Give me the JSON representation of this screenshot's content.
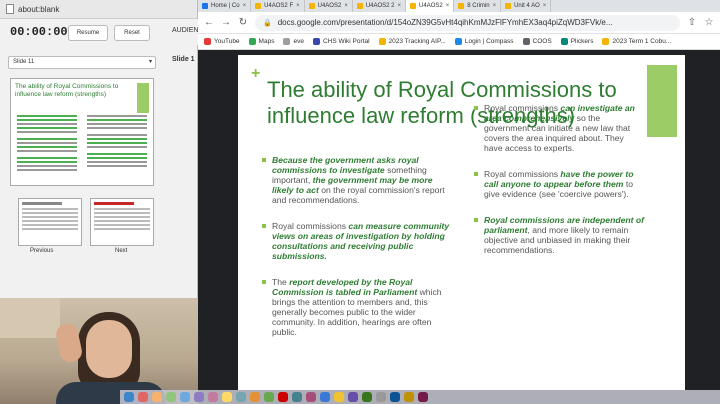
{
  "presenter": {
    "window_title": "about:blank",
    "timer": "00:00:00",
    "resume_label": "Resume",
    "reset_label": "Reset",
    "audience_label": "AUDIENC",
    "slide_selector": "Slide 11",
    "slide_label_right": "Slide 1",
    "prev_label": "Previous",
    "next_label": "Next",
    "thumb_title": "The ability of Royal Commissions to influence law reform (strengths)"
  },
  "browser": {
    "tabs": [
      {
        "label": "Home | Co",
        "color": "#1a73e8",
        "active": false
      },
      {
        "label": "U4AOS2 F",
        "color": "#f4b400",
        "active": false
      },
      {
        "label": "U4AOS2 ",
        "color": "#f4b400",
        "active": false
      },
      {
        "label": "U4AOS2 2",
        "color": "#f4b400",
        "active": false
      },
      {
        "label": "U4AOS2 ",
        "color": "#f4b400",
        "active": true
      },
      {
        "label": "8 Crimin",
        "color": "#f4b400",
        "active": false
      },
      {
        "label": "Unit 4 AO",
        "color": "#f4b400",
        "active": false
      }
    ],
    "url": "docs.google.com/presentation/d/154oZN39G5vHt4qihKmMJzFlFYmhEX3aq4piZqWD3FVk/e...",
    "bookmarks": [
      {
        "label": "YouTube",
        "color": "#e53935"
      },
      {
        "label": "Maps",
        "color": "#34a853"
      },
      {
        "label": "eve",
        "color": "#9e9e9e"
      },
      {
        "label": "CHS Wiki Portal",
        "color": "#3949ab"
      },
      {
        "label": "2023 Tracking AIP...",
        "color": "#f4b400"
      },
      {
        "label": "Login | Compass",
        "color": "#1e88e5"
      },
      {
        "label": "COOS",
        "color": "#5f6368"
      },
      {
        "label": "Plickers",
        "color": "#00897b"
      },
      {
        "label": "2023 Term 1 Cobu...",
        "color": "#f4b400"
      }
    ]
  },
  "slide": {
    "title": "The ability of Royal Commissions to influence law reform (strengths)",
    "left": {
      "b1_em1": "Because the government asks royal commissions to investigate",
      "b1_t1": " something important, ",
      "b1_em2": "the government may be more likely to act",
      "b1_t2": " on the royal commission's report and recommendations.",
      "b2_t1": "Royal commissions ",
      "b2_em1": "can measure community views on areas of investigation by holding consultations and receiving public submissions.",
      "b3_t1": "The ",
      "b3_em1": "report developed by the Royal Commission is tabled in Parliament",
      "b3_t2": " which brings the attention to members and, this generally becomes public to the wider community. In addition, hearings are often public."
    },
    "right": {
      "b1_t1": "Royal commissions ",
      "b1_em1": "can investigate an area comprehensively",
      "b1_t2": " so the government can initiate a new law that covers the area inquired about. They have access to experts.",
      "b2_t1": "Royal commissions ",
      "b2_em1": "have the power to call anyone to appear before them",
      "b2_t2": " to give evidence (see 'coercive powers').",
      "b3_em1": "Royal commissions are independent of parliament",
      "b3_t1": ", and more likely to remain objective and unbiased in making their recommendations."
    }
  },
  "dock_colors": [
    "#3d85c6",
    "#e06666",
    "#f6b26b",
    "#93c47d",
    "#6fa8dc",
    "#8e7cc3",
    "#c27ba0",
    "#ffd966",
    "#76a5af",
    "#e69138",
    "#6aa84f",
    "#cc0000",
    "#45818e",
    "#a64d79",
    "#3c78d8",
    "#f1c232",
    "#674ea7",
    "#38761d",
    "#999999",
    "#0b5394",
    "#bf9000",
    "#741b47"
  ]
}
